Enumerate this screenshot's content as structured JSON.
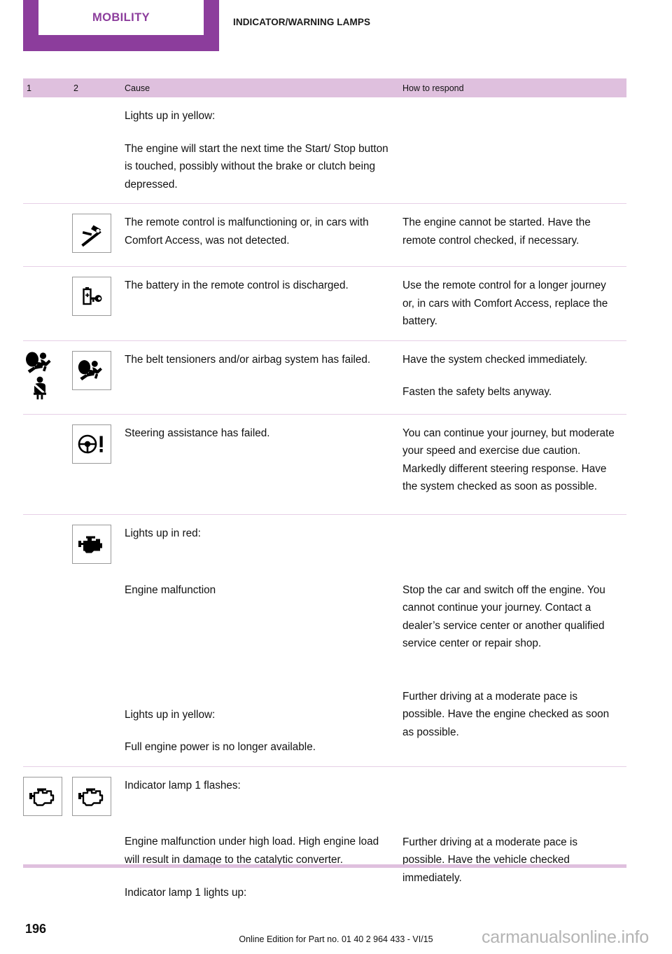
{
  "header": {
    "tab_label": "MOBILITY",
    "section_title": "INDICATOR/WARNING LAMPS"
  },
  "table": {
    "columns": {
      "col1": "1",
      "col2": "2",
      "cause": "Cause",
      "respond": "How to respond"
    },
    "rows": [
      {
        "icon1": "",
        "icon2": "",
        "cause_paragraphs": [
          "Lights up in yellow:",
          "The engine will start the next time the Start/ Stop button is touched, possibly without the brake or clutch being depressed."
        ],
        "respond_paragraphs": []
      },
      {
        "icon1": "",
        "icon2": "remote-control-key-icon",
        "cause_paragraphs": [
          "The remote control is malfunctioning or, in cars with Comfort Access, was not detected."
        ],
        "respond_paragraphs": [
          "The engine cannot be started. Have the remote control checked, if necessary."
        ]
      },
      {
        "icon1": "",
        "icon2": "battery-key-icon",
        "cause_paragraphs": [
          "The battery in the remote control is discharged."
        ],
        "respond_paragraphs": [
          "Use the remote control for a longer journey or, in cars with Comfort Access, replace the battery."
        ]
      },
      {
        "icon1": "airbag-icon,seatbelt-icon",
        "icon2": "airbag-icon",
        "cause_paragraphs": [
          "The belt tensioners and/or airbag system has failed."
        ],
        "respond_paragraphs": [
          "Have the system checked immediately.",
          "Fasten the safety belts anyway."
        ]
      },
      {
        "icon1": "",
        "icon2": "steering-wheel-warning-icon",
        "cause_paragraphs": [
          "Steering assistance has failed."
        ],
        "respond_paragraphs": [
          "You can continue your journey, but moderate your speed and exercise due caution. Markedly different steering response. Have the system checked as soon as possible."
        ]
      },
      {
        "icon1": "",
        "icon2": "engine-solid-icon",
        "cause_paragraphs": [
          "Lights up in red:",
          "Engine malfunction",
          "Lights up in yellow:",
          "Full engine power is no longer available."
        ],
        "respond_paragraphs": [
          "Stop the car and switch off the engine. You cannot continue your journey. Contact a dealer’s service center or another qualified service center or repair shop.",
          "Further driving at a moderate pace is possible. Have the engine checked as soon as possible."
        ]
      },
      {
        "icon1": "engine-outline-icon",
        "icon2": "engine-outline-icon",
        "cause_paragraphs": [
          "Indicator lamp 1 flashes:",
          "Engine malfunction under high load. High engine load will result in damage to the catalytic converter.",
          "Indicator lamp 1 lights up:"
        ],
        "respond_paragraphs": [
          "Further driving at a moderate pace is possible. Have the vehicle checked immediately."
        ]
      }
    ],
    "row1": {
      "p1": "Lights up in yellow:",
      "p2": "The engine will start the next time the Start/ Stop button is touched, possibly without the brake or clutch being depressed."
    },
    "row2": {
      "cause": "The remote control is malfunctioning or, in cars with Comfort Access, was not detected.",
      "respond": "The engine cannot be started. Have the remote control checked, if necessary."
    },
    "row3": {
      "cause": "The battery in the remote control is discharged.",
      "respond": "Use the remote control for a longer journey or, in cars with Comfort Access, replace the battery."
    },
    "row4": {
      "cause": "The belt tensioners and/or airbag system has failed.",
      "respond1": "Have the system checked immediately.",
      "respond2": "Fasten the safety belts anyway."
    },
    "row5": {
      "cause": "Steering assistance has failed.",
      "respond": "You can continue your journey, but moderate your speed and exercise due caution. Markedly different steering response. Have the system checked as soon as possible."
    },
    "row6": {
      "c1": "Lights up in red:",
      "c2": "Engine malfunction",
      "c3": "Lights up in yellow:",
      "c4": "Full engine power is no longer available.",
      "r1": "Stop the car and switch off the engine. You cannot continue your journey. Contact a dealer’s service center or another qualified service center or repair shop.",
      "r2": "Further driving at a moderate pace is possible. Have the engine checked as soon as possible."
    },
    "row7": {
      "c1": "Indicator lamp 1 flashes:",
      "c2": "Engine malfunction under high load. High engine load will result in damage to the catalytic converter.",
      "c3": "Indicator lamp 1 lights up:",
      "r1": "Further driving at a moderate pace is possible. Have the vehicle checked immediately."
    }
  },
  "footer": {
    "page_number": "196",
    "edition_text": "Online Edition for Part no. 01 40 2 964 433 - VI/15",
    "watermark": "carmanualsonline.info"
  },
  "colors": {
    "brand_purple": "#8c3d9c",
    "header_band": "#dfc0de",
    "rule": "#e6cfe6",
    "watermark_gray": "#b4b4b4"
  }
}
